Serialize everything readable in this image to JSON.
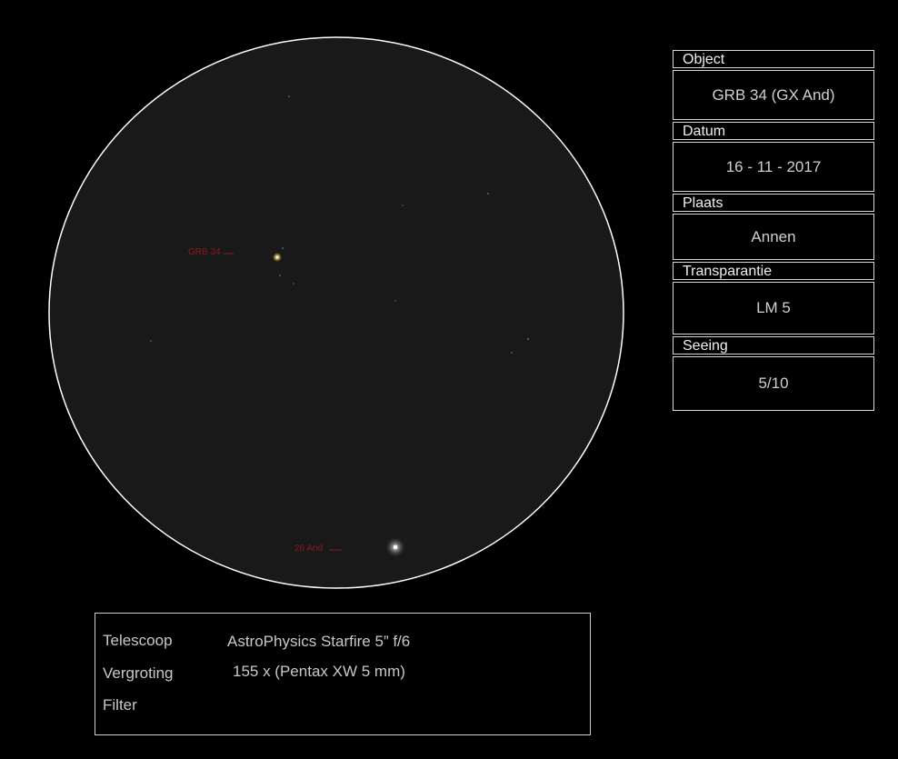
{
  "field_labels": {
    "target": "GRB 34",
    "reference": "26 And"
  },
  "info": {
    "object_header": "Object",
    "object_value": "GRB 34 (GX And)",
    "date_header": "Datum",
    "date_value": "16 - 11 - 2017",
    "place_header": "Plaats",
    "place_value": "Annen",
    "transparency_header": "Transparantie",
    "transparency_value": "LM 5",
    "seeing_header": "Seeing",
    "seeing_value": "5/10"
  },
  "equipment": {
    "telescope_label": "Telescoop",
    "telescope_value": "AstroPhysics Starfire 5” f/6",
    "magnification_label": "Vergroting",
    "magnification_value": "155 x (Pentax XW 5 mm)",
    "filter_label": "Filter",
    "filter_value": ""
  },
  "colors": {
    "field_background": "#191919",
    "field_border": "#ffffff",
    "label_color": "#8b1a1a",
    "target_star": "#ffd76a"
  }
}
